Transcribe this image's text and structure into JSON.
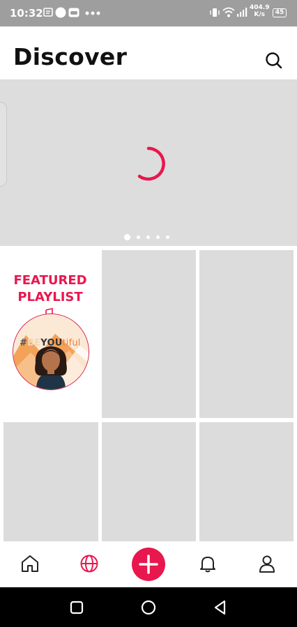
{
  "status_bar": {
    "time": "10:32",
    "net_speed_value": "404.9",
    "net_speed_unit": "K/s",
    "battery": "45",
    "icons": [
      "notification-icon",
      "circle-icon",
      "gamepad-icon",
      "more-dots-icon",
      "vibrate-icon",
      "wifi-icon",
      "signal-icon",
      "battery-icon"
    ]
  },
  "header": {
    "title": "Discover",
    "search_icon": "search-icon"
  },
  "banner": {
    "state": "loading",
    "pages": 5,
    "active_page": 1,
    "spinner_color": "#e8174d"
  },
  "featured": {
    "title_line1": "FEATURED",
    "title_line2": "PLAYLIST",
    "cover_text_hash": "#",
    "cover_text_be": "BE",
    "cover_text_you": "YOU",
    "cover_text_tiful": "tiful"
  },
  "bottom_nav": {
    "items": [
      "home-icon",
      "globe-icon",
      "add-button",
      "bell-icon",
      "profile-icon"
    ],
    "active": "globe-icon"
  },
  "system_nav": [
    "recents-button",
    "home-button",
    "back-button"
  ],
  "colors": {
    "accent": "#e8174d",
    "placeholder": "#dcdcdc",
    "statusbar": "#9e9e9e"
  }
}
